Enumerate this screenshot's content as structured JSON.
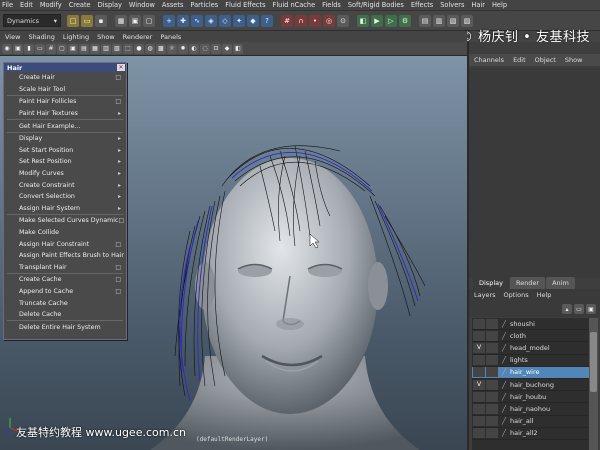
{
  "menubar": [
    "File",
    "Edit",
    "Modify",
    "Create",
    "Display",
    "Window",
    "Assets",
    "Particles",
    "Fluid Effects",
    "Fluid nCache",
    "Fields",
    "Soft/Rigid Bodies",
    "Effects",
    "Solvers",
    "Hair",
    "Help"
  ],
  "toolbar": {
    "mode": "Dynamics"
  },
  "panel_menu": [
    "View",
    "Shading",
    "Lighting",
    "Show",
    "Renderer",
    "Panels"
  ],
  "watermark_top": "© 杨庆钊 • 友基科技",
  "channel_box": {
    "tabs": [
      "Channels",
      "Edit",
      "Object",
      "Show"
    ]
  },
  "layer_editor": {
    "tabs": [
      "Display",
      "Render",
      "Anim"
    ],
    "active_tab": "Display",
    "menu": [
      "Layers",
      "Options",
      "Help"
    ],
    "layers": [
      {
        "name": "shoushi",
        "v": "",
        "sel": false
      },
      {
        "name": "cloth",
        "v": "",
        "sel": false
      },
      {
        "name": "head_model",
        "v": "V",
        "sel": false
      },
      {
        "name": "lights",
        "v": "",
        "sel": false
      },
      {
        "name": "hair_wire",
        "v": "",
        "sel": true
      },
      {
        "name": "hair_buchong",
        "v": "V",
        "sel": false
      },
      {
        "name": "hair_houbu",
        "v": "",
        "sel": false
      },
      {
        "name": "hair_naohou",
        "v": "",
        "sel": false
      },
      {
        "name": "hair_all",
        "v": "",
        "sel": false
      },
      {
        "name": "hair_all2",
        "v": "",
        "sel": false
      }
    ]
  },
  "hair_menu": {
    "title": "Hair",
    "items": [
      {
        "label": "Create Hair",
        "mark": "□"
      },
      {
        "label": "Scale Hair Tool",
        "mark": ""
      },
      {
        "sep": true
      },
      {
        "label": "Paint Hair Follicles",
        "mark": "□"
      },
      {
        "label": "Paint Hair Textures",
        "mark": "▸"
      },
      {
        "sep": true
      },
      {
        "label": "Get Hair Example...",
        "mark": ""
      },
      {
        "sep": true
      },
      {
        "label": "Display",
        "mark": "▸"
      },
      {
        "label": "Set Start Position",
        "mark": "▸"
      },
      {
        "label": "Set Rest Position",
        "mark": "▸"
      },
      {
        "label": "Modify Curves",
        "mark": "▸"
      },
      {
        "label": "Create Constraint",
        "mark": "▸"
      },
      {
        "label": "Convert Selection",
        "mark": "▸"
      },
      {
        "label": "Assign Hair System",
        "mark": "▸"
      },
      {
        "sep": true
      },
      {
        "label": "Make Selected Curves Dynamic",
        "mark": "□"
      },
      {
        "label": "Make Collide",
        "mark": ""
      },
      {
        "label": "Assign Hair Constraint",
        "mark": "□"
      },
      {
        "label": "Assign Paint Effects Brush to Hair",
        "mark": ""
      },
      {
        "label": "Transplant Hair",
        "mark": "□"
      },
      {
        "sep": true
      },
      {
        "label": "Create Cache",
        "mark": "□"
      },
      {
        "label": "Append to Cache",
        "mark": "□"
      },
      {
        "label": "Truncate Cache",
        "mark": ""
      },
      {
        "label": "Delete Cache",
        "mark": ""
      },
      {
        "sep": true
      },
      {
        "label": "Delete Entire Hair System",
        "mark": ""
      }
    ]
  },
  "viewport": {
    "render_layer": "(defaultRenderLayer)"
  },
  "watermark_bottom": "友基特约教程 www.ugee.com.cn"
}
